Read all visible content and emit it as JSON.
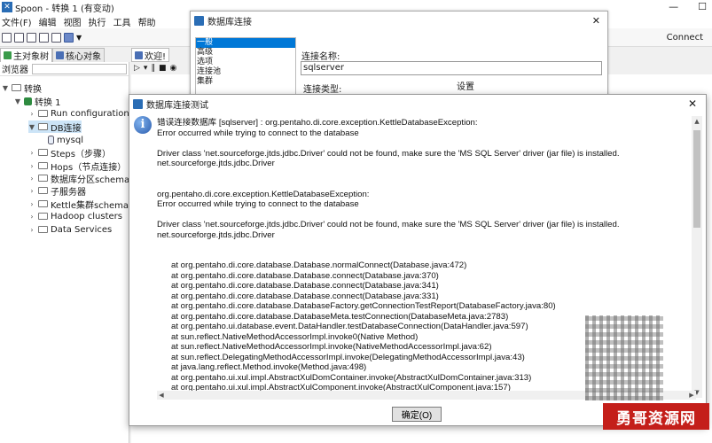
{
  "main_window": {
    "title": "Spoon - 转换 1 (有变动)",
    "menu": [
      "文件(F)",
      "编辑",
      "视图",
      "执行",
      "工具",
      "帮助"
    ],
    "connect_label": "Connect"
  },
  "left_panel": {
    "tabs": [
      "主对象树",
      "核心对象"
    ],
    "browse_label": "浏览器",
    "tree": [
      {
        "label": "转换",
        "level": 0
      },
      {
        "label": "转换 1",
        "level": 1
      },
      {
        "label": "Run configurations",
        "level": 2
      },
      {
        "label": "DB连接",
        "level": 2
      },
      {
        "label": "mysql",
        "level": 3
      },
      {
        "label": "Steps（步骤）",
        "level": 2
      },
      {
        "label": "Hops（节点连接）",
        "level": 2
      },
      {
        "label": "数据库分区schemas",
        "level": 2
      },
      {
        "label": "子服务器",
        "level": 2
      },
      {
        "label": "Kettle集群schemas",
        "level": 2
      },
      {
        "label": "Hadoop clusters",
        "level": 2
      },
      {
        "label": "Data Services",
        "level": 2
      }
    ]
  },
  "canvas": {
    "tab_label": "欢迎!"
  },
  "db_dialog": {
    "title": "数据库连接",
    "categories": [
      "一般",
      "高级",
      "选项",
      "连接池",
      "集群"
    ],
    "connection_name_label": "连接名称:",
    "connection_name_value": "sqlserver",
    "connection_type_label": "连接类型:",
    "settings_label": "设置"
  },
  "error_dialog": {
    "title": "数据库连接测试",
    "lines": [
      "错误连接数据库 [sqlserver] : org.pentaho.di.core.exception.KettleDatabaseException:",
      "Error occurred while trying to connect to the database"
    ],
    "lines2": [
      "Driver class 'net.sourceforge.jtds.jdbc.Driver' could not be found, make sure the 'MS SQL Server' driver (jar file) is installed.",
      "net.sourceforge.jtds.jdbc.Driver"
    ],
    "lines3": [
      "org.pentaho.di.core.exception.KettleDatabaseException:",
      "Error occurred while trying to connect to the database"
    ],
    "lines4": [
      "Driver class 'net.sourceforge.jtds.jdbc.Driver' could not be found, make sure the 'MS SQL Server' driver (jar file) is installed.",
      "net.sourceforge.jtds.jdbc.Driver"
    ],
    "stack": [
      "at org.pentaho.di.core.database.Database.normalConnect(Database.java:472)",
      "at org.pentaho.di.core.database.Database.connect(Database.java:370)",
      "at org.pentaho.di.core.database.Database.connect(Database.java:341)",
      "at org.pentaho.di.core.database.Database.connect(Database.java:331)",
      "at org.pentaho.di.core.database.DatabaseFactory.getConnectionTestReport(DatabaseFactory.java:80)",
      "at org.pentaho.di.core.database.DatabaseMeta.testConnection(DatabaseMeta.java:2783)",
      "at org.pentaho.ui.database.event.DataHandler.testDatabaseConnection(DataHandler.java:597)",
      "at sun.reflect.NativeMethodAccessorImpl.invoke0(Native Method)",
      "at sun.reflect.NativeMethodAccessorImpl.invoke(NativeMethodAccessorImpl.java:62)",
      "at sun.reflect.DelegatingMethodAccessorImpl.invoke(DelegatingMethodAccessorImpl.java:43)",
      "at java.lang.reflect.Method.invoke(Method.java:498)",
      "at org.pentaho.ui.xul.impl.AbstractXulDomContainer.invoke(AbstractXulDomContainer.java:313)",
      "at org.pentaho.ui.xul.impl.AbstractXulComponent.invoke(AbstractXulComponent.java:157)"
    ],
    "ok_label": "确定(O)"
  },
  "watermark": {
    "text": "勇哥资源网"
  }
}
